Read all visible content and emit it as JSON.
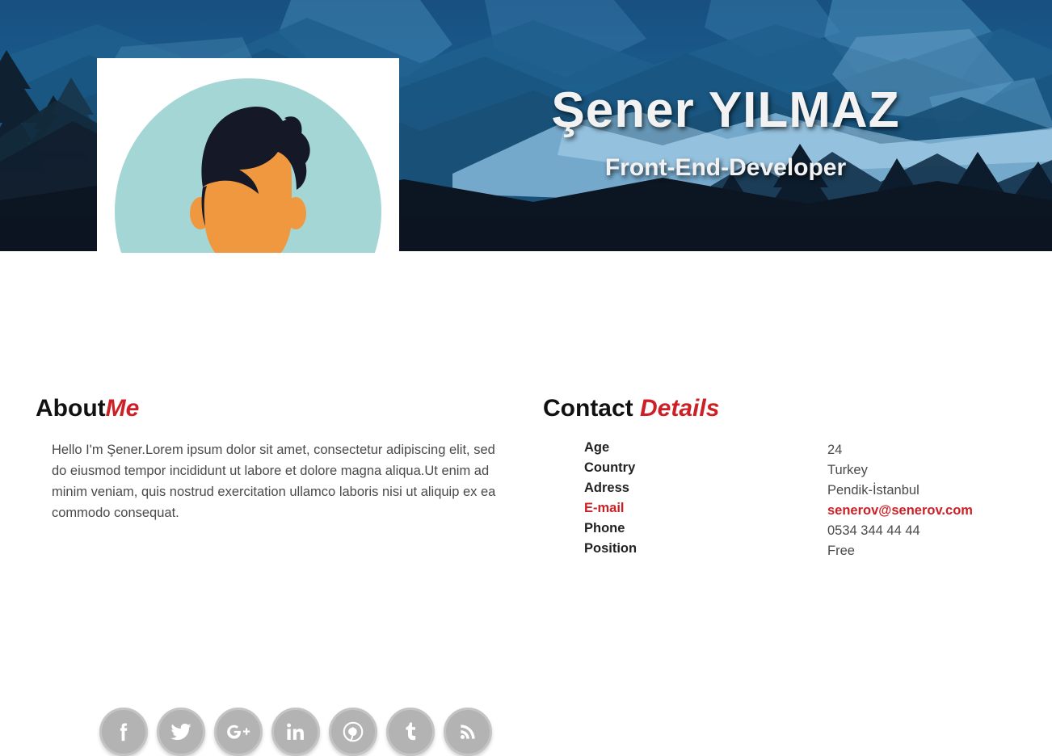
{
  "header": {
    "name": "Şener YILMAZ",
    "role": "Front-End-Developer",
    "avatar_alt": "avatar-illustration"
  },
  "about": {
    "heading_dark": "About",
    "heading_accent": "Me",
    "body": "Hello I'm Şener.Lorem ipsum dolor sit amet, consectetur adipiscing elit, sed do eiusmod tempor incididunt ut labore et dolore magna aliqua.Ut enim ad minim veniam, quis nostrud exercitation ullamco laboris nisi ut aliquip ex ea commodo consequat."
  },
  "contact": {
    "heading_dark": "Contact ",
    "heading_accent": "Details",
    "rows": [
      {
        "label": "Age",
        "value": "24",
        "accent": false
      },
      {
        "label": "Country",
        "value": "Turkey",
        "accent": false
      },
      {
        "label": "Adress",
        "value": "Pendik-İstanbul",
        "accent": false
      },
      {
        "label": "E-mail",
        "value": "senerov@senerov.com",
        "accent": true
      },
      {
        "label": "Phone",
        "value": "0534 344 44 44",
        "accent": false
      },
      {
        "label": "Position",
        "value": "Free",
        "accent": false
      }
    ]
  },
  "social": [
    {
      "name": "facebook-icon",
      "label": "Facebook"
    },
    {
      "name": "twitter-icon",
      "label": "Twitter"
    },
    {
      "name": "google-plus-icon",
      "label": "Google+"
    },
    {
      "name": "linkedin-icon",
      "label": "LinkedIn"
    },
    {
      "name": "pinterest-icon",
      "label": "Pinterest"
    },
    {
      "name": "tumblr-icon",
      "label": "Tumblr"
    },
    {
      "name": "rss-icon",
      "label": "RSS"
    }
  ],
  "colors": {
    "accent_red": "#cc2026",
    "header_dark": "#0c1520",
    "social_gray": "#b3b3b3",
    "text_gray": "#4a4a4a"
  }
}
